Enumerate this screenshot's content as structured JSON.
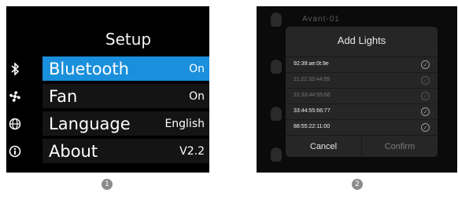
{
  "setup_screen": {
    "title": "Setup",
    "items": [
      {
        "label": "Bluetooth",
        "value": "On",
        "icon": "bluetooth-icon",
        "selected": true
      },
      {
        "label": "Fan",
        "value": "On",
        "icon": "fan-icon",
        "selected": false
      },
      {
        "label": "Language",
        "value": "English",
        "icon": "globe-icon",
        "selected": false
      },
      {
        "label": "About",
        "value": "V2.2",
        "icon": "info-icon",
        "selected": false
      }
    ],
    "highlight_color": "#1a8fdc"
  },
  "add_lights_screen": {
    "background_title": "Avant-01",
    "dialog_title": "Add Lights",
    "devices": [
      {
        "address": "92:39:ae:0t:9e",
        "available": true
      },
      {
        "address": "11:22:33:44:55",
        "available": false
      },
      {
        "address": "22:33:44:55:66",
        "available": false
      },
      {
        "address": "33:44:55:66:77",
        "available": true
      },
      {
        "address": "88:55:22:11:00",
        "available": true
      }
    ],
    "cancel_label": "Cancel",
    "confirm_label": "Confirm"
  },
  "steps": [
    "1",
    "2"
  ]
}
